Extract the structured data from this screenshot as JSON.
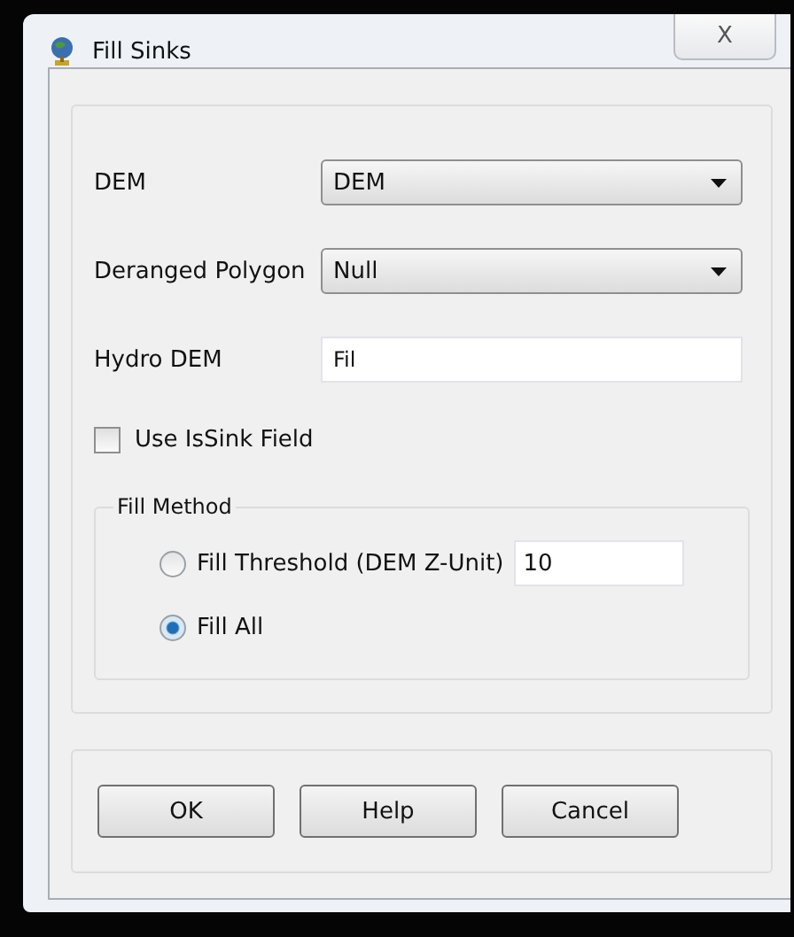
{
  "window": {
    "title": "Fill Sinks",
    "close": "X"
  },
  "fields": [
    {
      "kind": "dropdown",
      "label": "DEM",
      "value": "DEM"
    },
    {
      "kind": "dropdown",
      "label": "Deranged Polygon",
      "value": "Null"
    },
    {
      "kind": "text",
      "label": "Hydro DEM",
      "value": "Fil"
    }
  ],
  "use_issink": {
    "label": "Use IsSink Field",
    "checked": false
  },
  "fill_method": {
    "title": "Fill Method",
    "options": [
      {
        "label": "Fill Threshold (DEM Z-Unit)",
        "selected": false,
        "value": "10"
      },
      {
        "label": "Fill All",
        "selected": true
      }
    ]
  },
  "buttons": [
    "OK",
    "Help",
    "Cancel"
  ]
}
